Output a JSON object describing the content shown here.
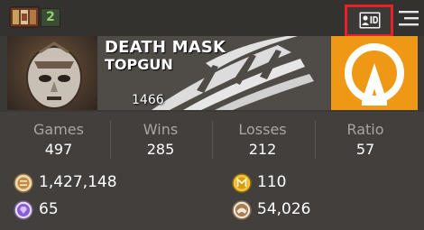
{
  "header": {
    "item_count": "2",
    "id_button_icon": "player-id-card-icon",
    "menu_icon": "hamburger-menu-icon",
    "inventory_icon": "inventory-icon"
  },
  "profile": {
    "player_name": "DEATH MASK",
    "clan_name": "TOPGUN",
    "rating": "1466"
  },
  "stats": {
    "games_label": "Games",
    "games_value": "497",
    "wins_label": "Wins",
    "wins_value": "285",
    "losses_label": "Losses",
    "losses_value": "212",
    "ratio_label": "Ratio",
    "ratio_value": "57"
  },
  "currencies": {
    "credits": "1,427,148",
    "medals": "110",
    "gems": "65",
    "experience": "54,026"
  },
  "colors": {
    "accent_red": "#e8202a",
    "count_green": "#8cd46c",
    "rank_orange": "#ee9815"
  }
}
